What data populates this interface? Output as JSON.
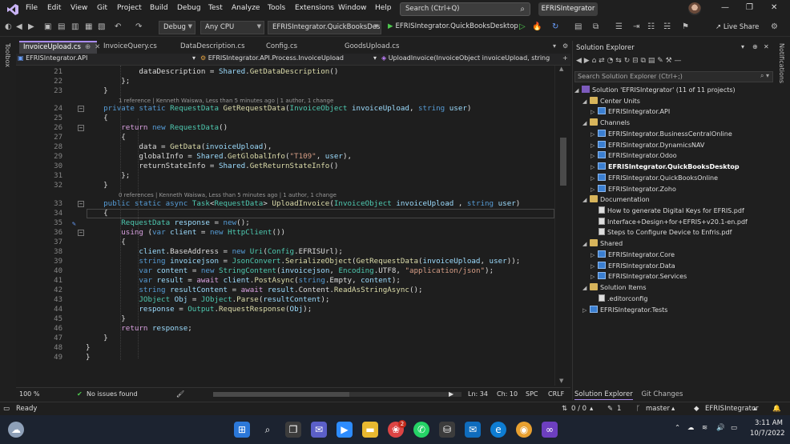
{
  "menu": [
    "File",
    "Edit",
    "View",
    "Git",
    "Project",
    "Build",
    "Debug",
    "Test",
    "Analyze",
    "Tools",
    "Extensions",
    "Window",
    "Help"
  ],
  "search_placeholder": "Search (Ctrl+Q)",
  "window_title": "EFRISIntegrator",
  "toolbar": {
    "config": "Debug",
    "platform": "Any CPU",
    "startup": "EFRISIntegrator.QuickBooksDeskto",
    "run_label": "EFRISIntegrator.QuickBooksDesktop",
    "live_share": "Live Share"
  },
  "side_tabs": {
    "left": "Toolbox",
    "right": "Notifications"
  },
  "doc_tabs": [
    {
      "label": "InvoiceUpload.cs",
      "active": true
    },
    {
      "label": "InvoiceQuery.cs",
      "active": false
    },
    {
      "label": "DataDescription.cs",
      "active": false
    },
    {
      "label": "Config.cs",
      "active": false
    },
    {
      "label": "GoodsUpload.cs",
      "active": false
    }
  ],
  "navbar": {
    "project": "EFRISIntegrator.API",
    "class": "EFRISIntegrator.API.Process.InvoiceUpload",
    "member": "UploadInvoice(InvoiceObject invoiceUpload, string"
  },
  "code_lens": {
    "line24": "1 reference | Kenneth Waiswa, Less than 5 minutes ago | 1 author, 1 change",
    "line33": "0 references | Kenneth Waiswa, Less than 5 minutes ago | 1 author, 1 change"
  },
  "editor_status": {
    "zoom": "100 %",
    "issues": "No issues found",
    "line": "Ln: 34",
    "col": "Ch: 10",
    "spc": "SPC",
    "crlf": "CRLF"
  },
  "solution_explorer": {
    "title": "Solution Explorer",
    "search": "Search Solution Explorer (Ctrl+;)",
    "tabs": [
      "Solution Explorer",
      "Git Changes"
    ],
    "items": [
      {
        "label": "Solution 'EFRISIntegrator' (11 of 11 projects)",
        "icon": "sln",
        "twisty": "",
        "bold": false
      },
      {
        "label": "Center Units",
        "icon": "folder",
        "twisty": "◢",
        "bold": false
      },
      {
        "label": "EFRISIntegrator.API",
        "icon": "proj",
        "twisty": "▷",
        "bold": false
      },
      {
        "label": "Channels",
        "icon": "folder",
        "twisty": "◢",
        "bold": false
      },
      {
        "label": "EFRISIntegrator.BusinessCentralOnline",
        "icon": "proj",
        "twisty": "▷",
        "bold": false
      },
      {
        "label": "EFRISIntegrator.DynamicsNAV",
        "icon": "proj",
        "twisty": "▷",
        "bold": false
      },
      {
        "label": "EFRISIntegrator.Odoo",
        "icon": "proj",
        "twisty": "▷",
        "bold": false
      },
      {
        "label": "EFRISIntegrator.QuickBooksDesktop",
        "icon": "proj",
        "twisty": "▷",
        "bold": true
      },
      {
        "label": "EFRISIntegrator.QuickBooksOnline",
        "icon": "proj",
        "twisty": "▷",
        "bold": false
      },
      {
        "label": "EFRISIntegrator.Zoho",
        "icon": "proj",
        "twisty": "▷",
        "bold": false
      },
      {
        "label": "Documentation",
        "icon": "folder",
        "twisty": "◢",
        "bold": false
      },
      {
        "label": "How to generate Digital Keys for EFRIS.pdf",
        "icon": "file",
        "twisty": "",
        "bold": false
      },
      {
        "label": "Interface+Design+for+EFRIS+v20.1-en.pdf",
        "icon": "file",
        "twisty": "",
        "bold": false
      },
      {
        "label": "Steps to Configure Device to Enfris.pdf",
        "icon": "file",
        "twisty": "",
        "bold": false
      },
      {
        "label": "Shared",
        "icon": "folder",
        "twisty": "◢",
        "bold": false
      },
      {
        "label": "EFRISIntegrator.Core",
        "icon": "proj",
        "twisty": "▷",
        "bold": false
      },
      {
        "label": "EFRISIntegrator.Data",
        "icon": "proj",
        "twisty": "▷",
        "bold": false
      },
      {
        "label": "EFRISIntegrator.Services",
        "icon": "proj",
        "twisty": "▷",
        "bold": false
      },
      {
        "label": "Solution Items",
        "icon": "folder",
        "twisty": "◢",
        "bold": false
      },
      {
        "label": ".editorconfig",
        "icon": "file",
        "twisty": "",
        "bold": false
      },
      {
        "label": "EFRISIntegrator.Tests",
        "icon": "proj",
        "twisty": "▷",
        "bold": false
      }
    ]
  },
  "statusbar": {
    "ready": "Ready",
    "arrows": "0 / 0",
    "pencil": "1",
    "branch": "master",
    "repo": "EFRISIntegrator"
  },
  "taskbar": {
    "time": "3:11 AM",
    "date": "10/7/2022",
    "badge": "2"
  },
  "colors": {
    "accent": "#a98cef",
    "bg": "#1e1e1e",
    "keyword": "#569cd6",
    "type": "#4ec9b0"
  }
}
